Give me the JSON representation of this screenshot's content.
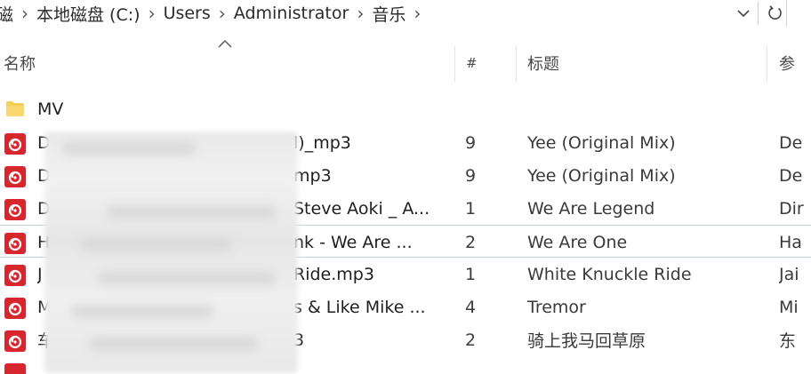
{
  "address_bar": {
    "crumbs": [
      "磁",
      "本地磁盘 (C:)",
      "Users",
      "Administrator",
      "音乐"
    ],
    "separator": "›",
    "dropdown_icon": "chevron-down-icon",
    "refresh_icon": "refresh-icon"
  },
  "columns": {
    "name": "名称",
    "number": "#",
    "title": "标题",
    "artist": "参"
  },
  "folder": {
    "name": "MV",
    "icon": "folder-icon"
  },
  "rows": [
    {
      "name_lead": "D",
      "name_tail": "l)_mp3",
      "number": "9",
      "title": "Yee (Original Mix)",
      "artist": "De"
    },
    {
      "name_lead": "D",
      "name_tail": "mp3",
      "number": "9",
      "title": "Yee (Original Mix)",
      "artist": "De"
    },
    {
      "name_lead": "D",
      "name_tail": "Steve Aoki _ A...",
      "number": "1",
      "title": "We Are Legend",
      "artist": "Dir"
    },
    {
      "name_lead": "H",
      "name_tail": "nk - We Are ...",
      "number": "2",
      "title": "We Are One",
      "artist": "Ha"
    },
    {
      "name_lead": "J",
      "name_tail": "Ride.mp3",
      "number": "1",
      "title": "White Knuckle Ride",
      "artist": "Jai"
    },
    {
      "name_lead": "M",
      "name_tail": "s & Like Mike ...",
      "number": "4",
      "title": "Tremor",
      "artist": "Mi"
    },
    {
      "name_lead": "车",
      "name_tail": "3",
      "number": "2",
      "title": "骑上我马回草原",
      "artist": "东"
    }
  ],
  "colors": {
    "music_icon_red": "#d8262f",
    "folder_yellow": "#f4cf58",
    "row_outline": "#b9d7ea"
  }
}
